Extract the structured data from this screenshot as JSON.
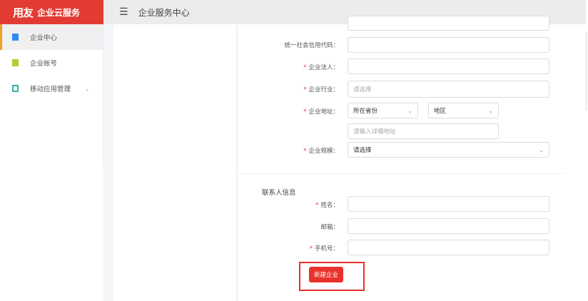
{
  "brand": {
    "logo": "用友",
    "service": "企业云服务"
  },
  "header": {
    "title": "企业服务中心",
    "menu_icon": "hamburger-icon"
  },
  "sidebar": {
    "items": [
      {
        "label": "企业中心",
        "icon": "building-icon",
        "active": true,
        "color": "#2d8cf0"
      },
      {
        "label": "企业帐号",
        "icon": "account-icon",
        "color": "#b5cc2f"
      },
      {
        "label": "移动应用管理",
        "icon": "mobile-icon",
        "color": "#2ab3a6"
      }
    ]
  },
  "form": {
    "fields": [
      {
        "label": "统一社会信用代码：",
        "required": false,
        "value": ""
      },
      {
        "label": "企业法人：",
        "required": true,
        "value": ""
      },
      {
        "label": "企业行业：",
        "required": true,
        "placeholder": "请选择"
      },
      {
        "label": "企业地址：",
        "required": true,
        "province": "所在省份",
        "region": "地区",
        "detail_placeholder": "请输入详细地址"
      },
      {
        "label": "企业规模：",
        "required": true,
        "value": "请选择"
      }
    ],
    "contact_section": "联系人信息",
    "contact": [
      {
        "label": "姓名：",
        "required": true,
        "value": ""
      },
      {
        "label": "邮箱：",
        "required": false,
        "value": ""
      },
      {
        "label": "手机号：",
        "required": true,
        "value": ""
      }
    ],
    "submit": "新建企业",
    "required_mark": "*"
  },
  "accent": "#e23b34"
}
